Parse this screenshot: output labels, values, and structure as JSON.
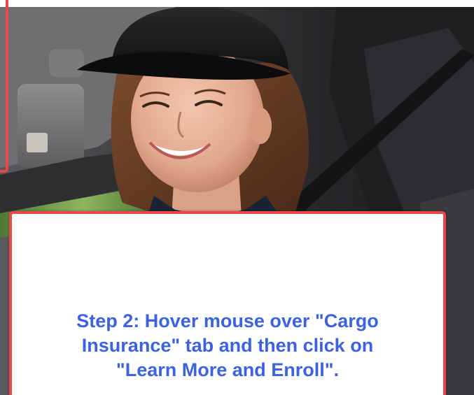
{
  "callout": {
    "lines": [
      "Step 2:  Hover mouse over \"Cargo",
      "Insurance\" tab and then click on",
      "\"Learn More and Enroll\"."
    ],
    "text_color": "#3b63e0",
    "border_color": "#e8474c"
  },
  "photo": {
    "subject": "smiling-woman-driver-in-black-cap"
  }
}
